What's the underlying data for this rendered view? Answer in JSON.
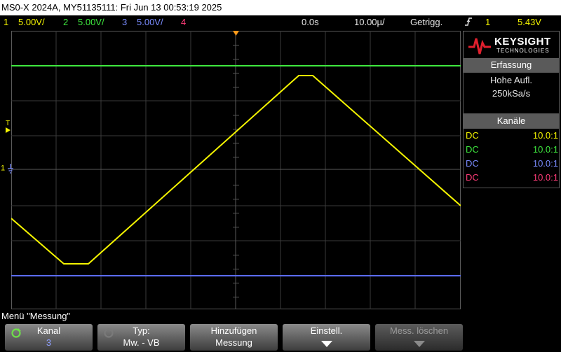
{
  "window": {
    "title": "MS0-X 2024A, MY51135111: Fri Jun 13 00:53:19 2025"
  },
  "status": {
    "ch1_num": "1",
    "ch1_scale": "5.00V/",
    "ch2_num": "2",
    "ch2_scale": "5.00V/",
    "ch3_num": "3",
    "ch3_scale": "5.00V/",
    "ch4_num": "4",
    "time_offset": "0.0s",
    "time_scale": "10.00µ/",
    "trigger_state": "Getrigg.",
    "trigger_source": "1",
    "trigger_level": "5.43V"
  },
  "colors": {
    "ch1": "#f5f500",
    "ch2": "#3ee83e",
    "ch3": "#5b6cff",
    "ch4": "#ff3c78",
    "panel_header": "#5a5a5a"
  },
  "icons": [
    "trigger-edge-icon",
    "trigger-position-icon",
    "keysight-logo-icon",
    "ground-marker-icon",
    "knob-icon",
    "down-arrow-icon"
  ],
  "markers": {
    "trigger_level": "T",
    "ground": "1"
  },
  "side_panel": {
    "brand": "KEYSIGHT",
    "brand_sub": "TECHNOLOGIES",
    "acquisition": {
      "header": "Erfassung",
      "mode": "Hohe Aufl.",
      "rate": "250kSa/s"
    },
    "channels": {
      "header": "Kanäle",
      "rows": [
        {
          "coupling": "DC",
          "probe": "10.0:1"
        },
        {
          "coupling": "DC",
          "probe": "10.0:1"
        },
        {
          "coupling": "DC",
          "probe": "10.0:1"
        },
        {
          "coupling": "DC",
          "probe": "10.0:1"
        }
      ]
    }
  },
  "menu": {
    "title": "Menü \"Messung\"",
    "softkeys": [
      {
        "line1": "Kanal",
        "line2": "3"
      },
      {
        "line1": "Typ:",
        "line2": "Mw. - VB"
      },
      {
        "line1": "Hinzufügen",
        "line2": "Messung"
      },
      {
        "line1": "Einstell.",
        "line2": ""
      },
      {
        "line1": "Mess. löschen",
        "line2": ""
      }
    ]
  }
}
